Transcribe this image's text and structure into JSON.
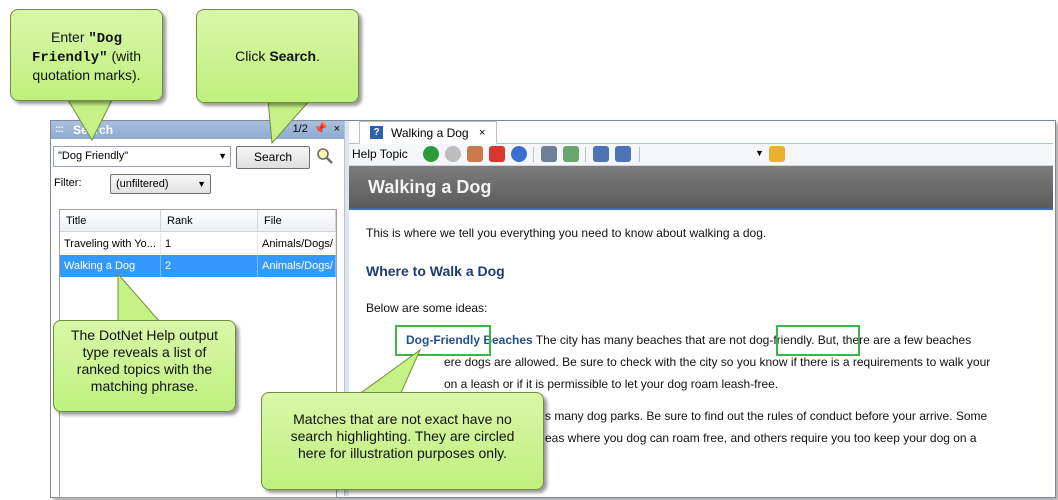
{
  "search_pane": {
    "title": "Search",
    "grip_icon": ":::",
    "paging": "1/2",
    "close": "×",
    "query": "\"Dog Friendly\"",
    "search_button": "Search",
    "filter_label": "Filter:",
    "filter_value": "(unfiltered)",
    "columns": [
      "Title",
      "Rank",
      "File"
    ],
    "results": [
      {
        "title": "Traveling with Yo...",
        "rank": "1",
        "file": "Animals/Dogs/"
      },
      {
        "title": "Walking a Dog",
        "rank": "2",
        "file": "Animals/Dogs/",
        "selected": true
      }
    ]
  },
  "document": {
    "tab_label": "Walking a Dog",
    "tab_close": "×",
    "toolbar_label": "Help Topic",
    "topic_title": "Walking a Dog",
    "intro": "This is where we tell you everything you need to know about walking a dog.",
    "heading": "Where to Walk a Dog",
    "ideas_intro": "Below are some ideas:",
    "beaches": {
      "keyword1": "Dog-Friendly",
      "keyword2": "Beaches",
      "text_a": " The city has many beaches that are not ",
      "match": "dog-friendly",
      "text_b": ". But, there are a few beaches",
      "line2": "ere dogs are allowed. Be sure to check with the city so you know if there is a requirements to walk your",
      "line3": "on a leash or if it is permissible to let your dog roam leash-free."
    },
    "parks": {
      "line1": "s many dog parks. Be sure to find out the rules of conduct before your arrive. Some",
      "line2": "eas where you dog can roam free, and others require you too keep your dog on a"
    }
  },
  "callouts": {
    "enter_pre": "Enter ",
    "enter_code1": "\"Dog",
    "enter_code2": "Friendly\"",
    "enter_post": " (with",
    "enter_line3": "quotation marks).",
    "click_pre": "Click ",
    "click_bold": "Search",
    "click_post": ".",
    "dotnet": "The DotNet Help output type reveals a list of ranked topics with the matching phrase.",
    "matches": "Matches that are not exact have no search highlighting. They are circled here for illustration purposes only."
  },
  "colors": {
    "callout_fill": "#c9f38c",
    "selection": "#3399ff",
    "match_circle": "#3cb54a",
    "heading": "#1c3d72"
  }
}
